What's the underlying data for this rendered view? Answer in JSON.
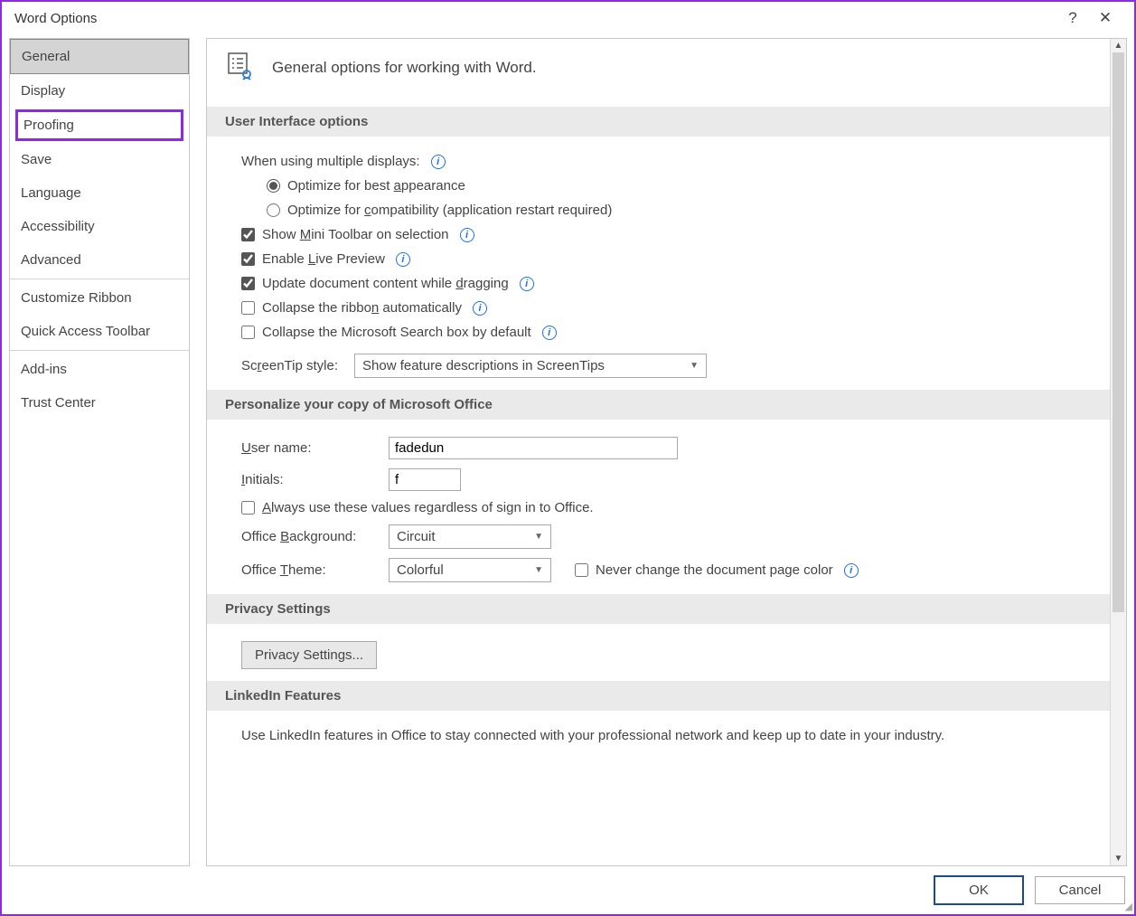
{
  "window": {
    "title": "Word Options"
  },
  "sidebar": {
    "items": [
      {
        "label": "General",
        "selected": true
      },
      {
        "label": "Display"
      },
      {
        "label": "Proofing",
        "highlighted": true
      },
      {
        "label": "Save"
      },
      {
        "label": "Language"
      },
      {
        "label": "Accessibility"
      },
      {
        "label": "Advanced"
      },
      {
        "label": "Customize Ribbon"
      },
      {
        "label": "Quick Access Toolbar"
      },
      {
        "label": "Add-ins"
      },
      {
        "label": "Trust Center"
      }
    ]
  },
  "main": {
    "heading": "General options for working with Word.",
    "sections": {
      "ui": {
        "title": "User Interface options",
        "multi_displays_label": "When using multiple displays:",
        "opt_best": "Optimize for best appearance",
        "opt_compat": "Optimize for compatibility (application restart required)",
        "show_mini": "Show Mini Toolbar on selection",
        "live_preview": "Enable Live Preview",
        "update_drag": "Update document content while dragging",
        "collapse_ribbon": "Collapse the ribbon automatically",
        "collapse_search": "Collapse the Microsoft Search box by default",
        "screentip_label": "ScreenTip style:",
        "screentip_value": "Show feature descriptions in ScreenTips"
      },
      "personalize": {
        "title": "Personalize your copy of Microsoft Office",
        "username_label": "User name:",
        "username_value": "fadedun",
        "initials_label": "Initials:",
        "initials_value": "f",
        "always_use": "Always use these values regardless of sign in to Office.",
        "bg_label": "Office Background:",
        "bg_value": "Circuit",
        "theme_label": "Office Theme:",
        "theme_value": "Colorful",
        "never_change": "Never change the document page color"
      },
      "privacy": {
        "title": "Privacy Settings",
        "button": "Privacy Settings..."
      },
      "linkedin": {
        "title": "LinkedIn Features",
        "desc": "Use LinkedIn features in Office to stay connected with your professional network and keep up to date in your industry."
      }
    }
  },
  "footer": {
    "ok": "OK",
    "cancel": "Cancel"
  }
}
